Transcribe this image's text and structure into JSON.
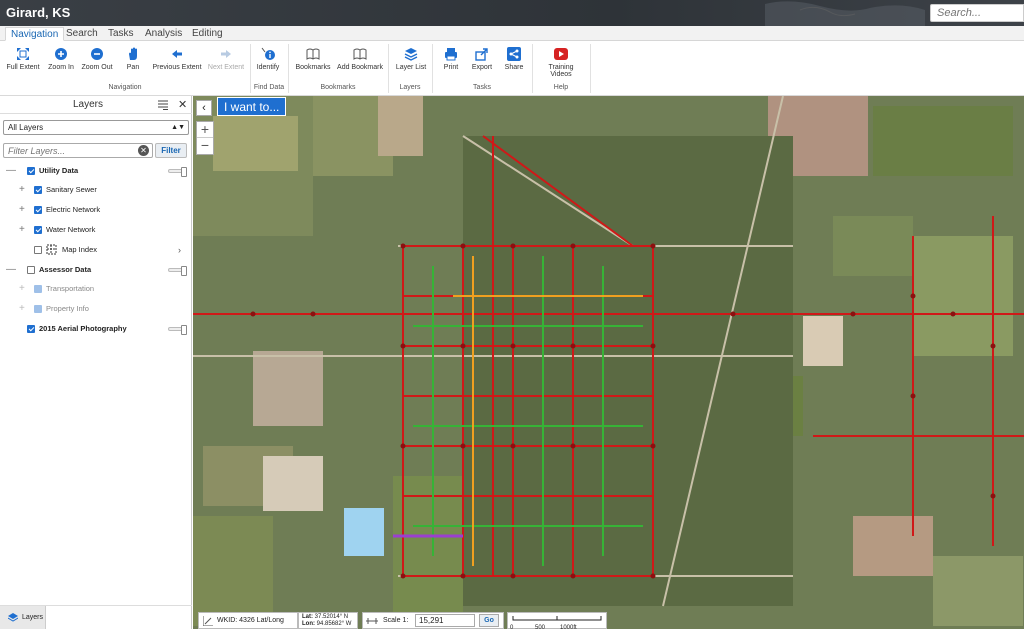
{
  "app": {
    "title": "Girard, KS",
    "search_placeholder": "Search..."
  },
  "tabs": [
    {
      "label": "Navigation",
      "active": true
    },
    {
      "label": "Search"
    },
    {
      "label": "Tasks"
    },
    {
      "label": "Analysis"
    },
    {
      "label": "Editing"
    }
  ],
  "ribbon": {
    "buttons": {
      "full_extent": "Full Extent",
      "zoom_in": "Zoom In",
      "zoom_out": "Zoom Out",
      "pan": "Pan",
      "previous_extent": "Previous Extent",
      "next_extent": "Next Extent",
      "identify": "Identify",
      "bookmarks": "Bookmarks",
      "add_bookmark": "Add Bookmark",
      "layer_list": "Layer List",
      "print": "Print",
      "export": "Export",
      "share": "Share",
      "training_videos": "Training Videos"
    },
    "groups": {
      "navigation": "Navigation",
      "find_data": "Find Data",
      "bookmarks": "Bookmarks",
      "layers": "Layers",
      "tasks": "Tasks",
      "help": "Help"
    }
  },
  "layers_panel": {
    "title": "Layers",
    "select_value": "All Layers",
    "filter_placeholder": "Filter Layers...",
    "filter_button": "Filter",
    "items": [
      {
        "label": "Utility Data"
      },
      {
        "label": "Sanitary Sewer"
      },
      {
        "label": "Electric Network"
      },
      {
        "label": "Water Network"
      },
      {
        "label": "Map Index"
      },
      {
        "label": "Assessor Data"
      },
      {
        "label": "Transportation"
      },
      {
        "label": "Property Info"
      },
      {
        "label": "2015 Aerial Photography"
      }
    ],
    "footer_tab": "Layers"
  },
  "map": {
    "i_want_to": "I want to...",
    "wkid": "WKID: 4326 Lat/Long",
    "lat_label": "Lat:",
    "lat_value": "37.52014° N",
    "lon_label": "Lon:",
    "lon_value": "94.85682° W",
    "scale_label": "Scale 1:",
    "scale_value": "15,291",
    "go_label": "Go",
    "scalebar_ticks": [
      "0",
      "500",
      "1000ft"
    ]
  },
  "colors": {
    "accent": "#1f6fd0",
    "sewer": "#d01818",
    "water": "#36b336",
    "electric": "#f0a020",
    "sewer_node": "#8b1010"
  }
}
